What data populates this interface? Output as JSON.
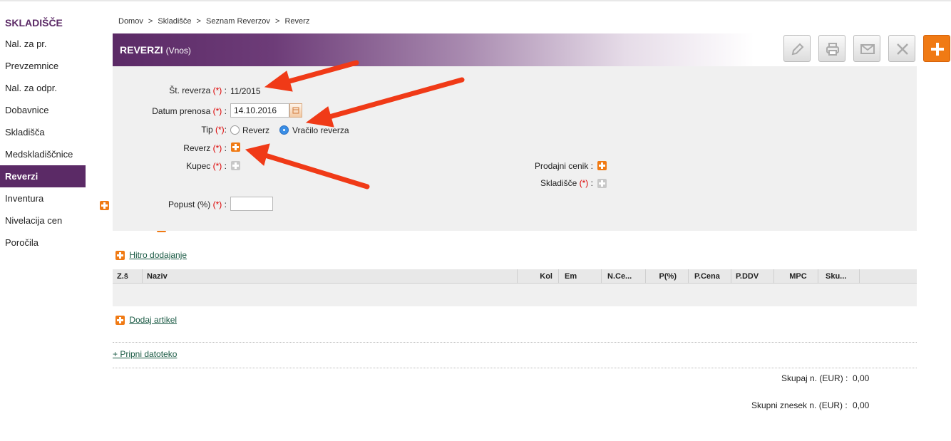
{
  "sidebar": {
    "title": "SKLADIŠČE",
    "items": [
      {
        "label": "Nal. za pr.",
        "plus": true
      },
      {
        "label": "Prevzemnice",
        "plus": true
      },
      {
        "label": "Nal. za odpr.",
        "plus": true
      },
      {
        "label": "Dobavnice",
        "plus": true
      },
      {
        "label": "Skladišča",
        "plus": true
      },
      {
        "label": "Medskladiščnice",
        "plus": true
      },
      {
        "label": "Reverzi",
        "plus": true,
        "active": true
      },
      {
        "label": "Inventura",
        "plus": true
      },
      {
        "label": "Nivelacija cen",
        "plus": true
      },
      {
        "label": "Poročila",
        "plus": false
      }
    ]
  },
  "breadcrumb": {
    "items": [
      "Domov",
      "Skladišče",
      "Seznam Reverzov",
      "Reverz"
    ],
    "separator": ">"
  },
  "header": {
    "title": "REVERZI",
    "subtitle": "(Vnos)"
  },
  "toolbar": [
    "pencil-icon",
    "print-icon",
    "mail-icon",
    "close-icon",
    "add-icon"
  ],
  "form": {
    "st_reverza_label": "Št. reverza",
    "st_reverza_value": "11/2015",
    "datum_label": "Datum prenosa",
    "datum_value": "14.10.2016",
    "tip_label": "Tip",
    "tip_option1": "Reverz",
    "tip_option2": "Vračilo reverza",
    "tip_selected": "Vračilo reverza",
    "reverz_label": "Reverz",
    "kupec_label": "Kupec",
    "prodajni_cenik_label": "Prodajni cenik",
    "skladisce_label": "Skladišče",
    "popust_label": "Popust (%)",
    "popust_value": "",
    "required_mark": "(*)",
    "colon": ":"
  },
  "hitro_dodajanje": "Hitro dodajanje",
  "table": {
    "columns": [
      "Z.š",
      "Naziv",
      "Kol",
      "Em",
      "N.Ce...",
      "P(%)",
      "P.Cena",
      "P.DDV",
      "MPC",
      "Sku..."
    ]
  },
  "dodaj_artikel": "Dodaj artikel",
  "pripni_datoteko": "+ Pripni datoteko",
  "totals": {
    "skupaj_label": "Skupaj n. (EUR) :",
    "skupaj_value": "0,00",
    "skupni_znesek_label": "Skupni znesek n. (EUR) :",
    "skupni_znesek_value": "0,00"
  },
  "colors": {
    "brand": "#5b2a66",
    "accent": "#f07a14",
    "arrow": "#f03a17"
  }
}
